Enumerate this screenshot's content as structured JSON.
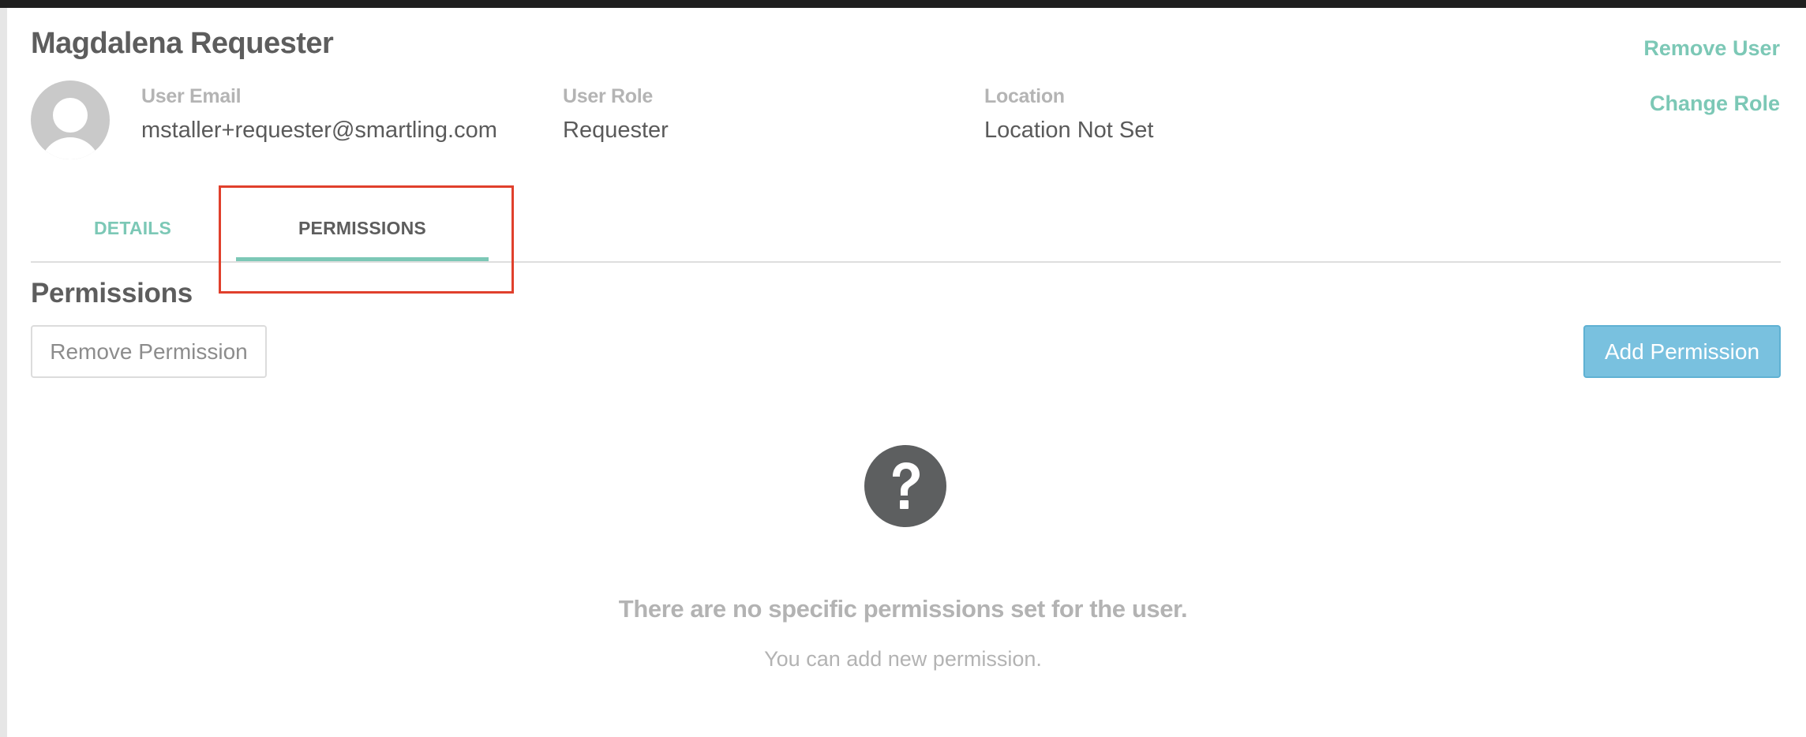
{
  "user": {
    "name": "Magdalena Requester",
    "email_label": "User Email",
    "email": "mstaller+requester@smartling.com",
    "role_label": "User Role",
    "role": "Requester",
    "location_label": "Location",
    "location": "Location Not Set"
  },
  "actions": {
    "remove_user": "Remove User",
    "change_role": "Change Role"
  },
  "tabs": [
    {
      "label": "DETAILS",
      "active": false
    },
    {
      "label": "PERMISSIONS",
      "active": true
    }
  ],
  "permissions": {
    "title": "Permissions",
    "remove_button": "Remove Permission",
    "add_button": "Add Permission",
    "empty_icon": "question-circle-icon",
    "empty_title": "There are no specific permissions set for the user.",
    "empty_subtitle": "You can add new permission."
  },
  "colors": {
    "accent": "#7cc8b6",
    "primary_button": "#79c1df",
    "highlight": "#e0402c"
  }
}
